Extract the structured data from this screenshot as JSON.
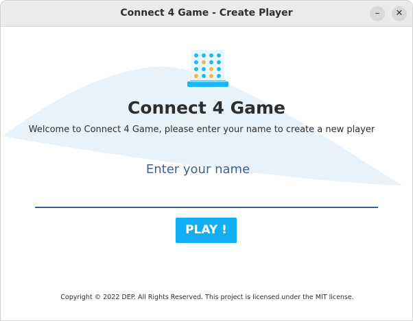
{
  "window": {
    "title": "Connect 4 Game - Create Player",
    "minimize_icon": "minimize-icon",
    "close_icon": "close-icon"
  },
  "main": {
    "logo_icon": "connect-four-board-icon",
    "heading": "Connect 4 Game",
    "subtitle": "Welcome to Connect 4 Game, please enter your name to create a new player",
    "name_input": {
      "label": "Enter your name",
      "value": ""
    },
    "play_button": "PLAY !"
  },
  "footer": {
    "copyright": "Copyright © 2022 DEP. All Rights Reserved. This project is licensed under the MIT license."
  },
  "colors": {
    "accent": "#12aef3",
    "input_text": "#3f5f95",
    "background_shape": "#e8f2fb",
    "titlebar": "#ebebeb"
  }
}
